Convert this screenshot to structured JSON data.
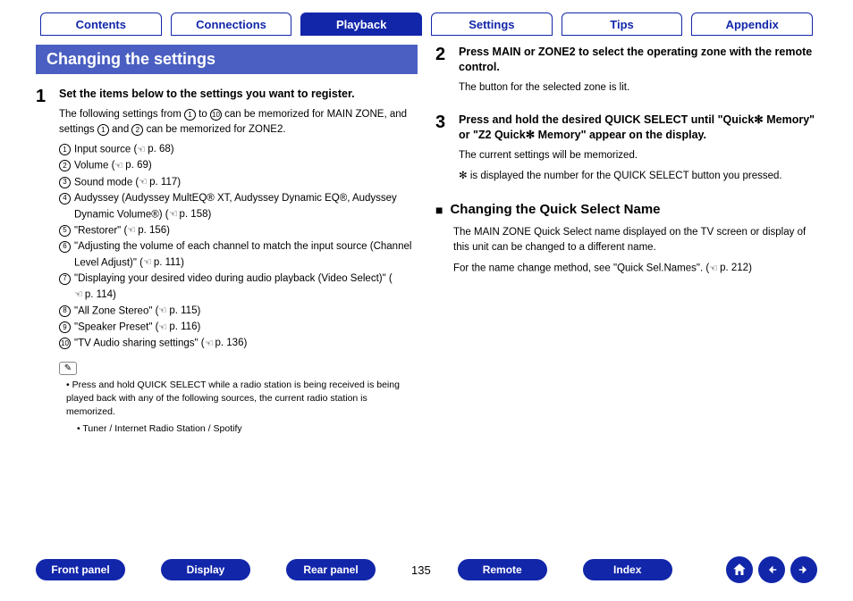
{
  "tabs": {
    "items": [
      {
        "label": "Contents",
        "active": false
      },
      {
        "label": "Connections",
        "active": false
      },
      {
        "label": "Playback",
        "active": true
      },
      {
        "label": "Settings",
        "active": false
      },
      {
        "label": "Tips",
        "active": false
      },
      {
        "label": "Appendix",
        "active": false
      }
    ]
  },
  "section_title": "Changing the settings",
  "step1": {
    "num": "1",
    "title": "Set the items below to the settings you want to register.",
    "desc_a": "The following settings from ",
    "desc_b": " to ",
    "desc_c": " can be memorized for MAIN ZONE, and settings ",
    "desc_d": " and ",
    "desc_e": " can be memorized for ZONE2.",
    "marker_1": "1",
    "marker_10": "10",
    "marker_2": "2",
    "items": [
      {
        "n": "1",
        "text": "Input source  ",
        "page": "p. 68"
      },
      {
        "n": "2",
        "text": "Volume  ",
        "page": "p. 69"
      },
      {
        "n": "3",
        "text": "Sound mode  ",
        "page": "p. 117"
      },
      {
        "n": "4",
        "text": "Audyssey (Audyssey MultEQ® XT, Audyssey Dynamic EQ®, Audyssey Dynamic Volume®)  ",
        "page": "p. 158"
      },
      {
        "n": "5",
        "text": "\"Restorer\" ",
        "page": "p. 156"
      },
      {
        "n": "6",
        "text": "\"Adjusting the volume of each channel to match the input source (Channel Level Adjust)\" ",
        "page": "p. 111"
      },
      {
        "n": "7",
        "text": "\"Displaying your desired video during audio playback (Video Select)\" ",
        "page": "p. 114"
      },
      {
        "n": "8",
        "text": "\"All Zone Stereo\"  ",
        "page": "p. 115"
      },
      {
        "n": "9",
        "text": "\"Speaker Preset\"  ",
        "page": "p. 116"
      },
      {
        "n": "10",
        "text": "\"TV Audio sharing settings\" ",
        "page": "p. 136"
      }
    ]
  },
  "note": {
    "bullet": "Press and hold QUICK SELECT while a radio station is being received is being played back with any of the following sources, the current radio station is memorized.",
    "sub": "Tuner / Internet Radio Station / Spotify"
  },
  "step2": {
    "num": "2",
    "title": "Press MAIN or ZONE2 to select the operating zone with the remote control.",
    "desc": "The button for the selected zone is lit."
  },
  "step3": {
    "num": "3",
    "title": "Press and hold the desired QUICK SELECT until \"Quick✻ Memory\" or \"Z2 Quick✻ Memory\" appear on the display.",
    "desc1": "The current settings will be memorized.",
    "desc2": "✻ is displayed the number for the QUICK SELECT button you pressed."
  },
  "subsection": {
    "title": "Changing the Quick Select Name",
    "p1": "The MAIN ZONE Quick Select name displayed on the TV screen or display of this unit can be changed to a different name.",
    "p2_a": "For the name change method, see \"Quick Sel.Names\".  ",
    "p2_page": "p. 212"
  },
  "bottom": {
    "pills": [
      "Front panel",
      "Display",
      "Rear panel"
    ],
    "page": "135",
    "pills2": [
      "Remote",
      "Index"
    ]
  }
}
